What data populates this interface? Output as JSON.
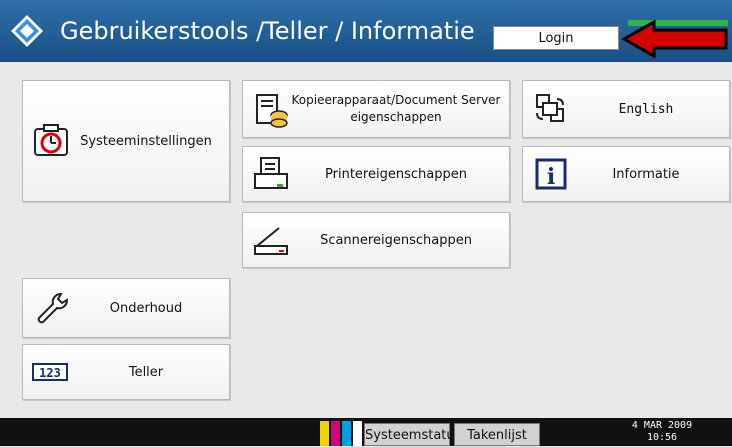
{
  "header": {
    "title": "Gebruikerstools /Teller / Informatie",
    "login_label": "Login",
    "colors": {
      "background": "#1f5b95",
      "arrow": "#d40000",
      "arrow_outline": "#000000"
    }
  },
  "buttons": {
    "systeeminstellingen": "Systeeminstellingen",
    "kopieer_line1": "Kopieerapparaat/Document Server",
    "kopieer_line2": "eigenschappen",
    "printer": "Printereigenschappen",
    "scanner": "Scannereigenschappen",
    "english": "English",
    "informatie": "Informatie",
    "onderhoud": "Onderhoud",
    "teller": "Teller",
    "teller_icon_text": "123"
  },
  "status_bar": {
    "systeemstatus": "Systeemstatus",
    "takenlijst": "Takenlijst",
    "date": "4 MAR  2009",
    "time": "10:56"
  },
  "icons": [
    "settings-icon",
    "copier-icon",
    "printer-icon",
    "scanner-icon",
    "language-switch-icon",
    "info-icon",
    "wrench-icon",
    "counter-icon"
  ]
}
